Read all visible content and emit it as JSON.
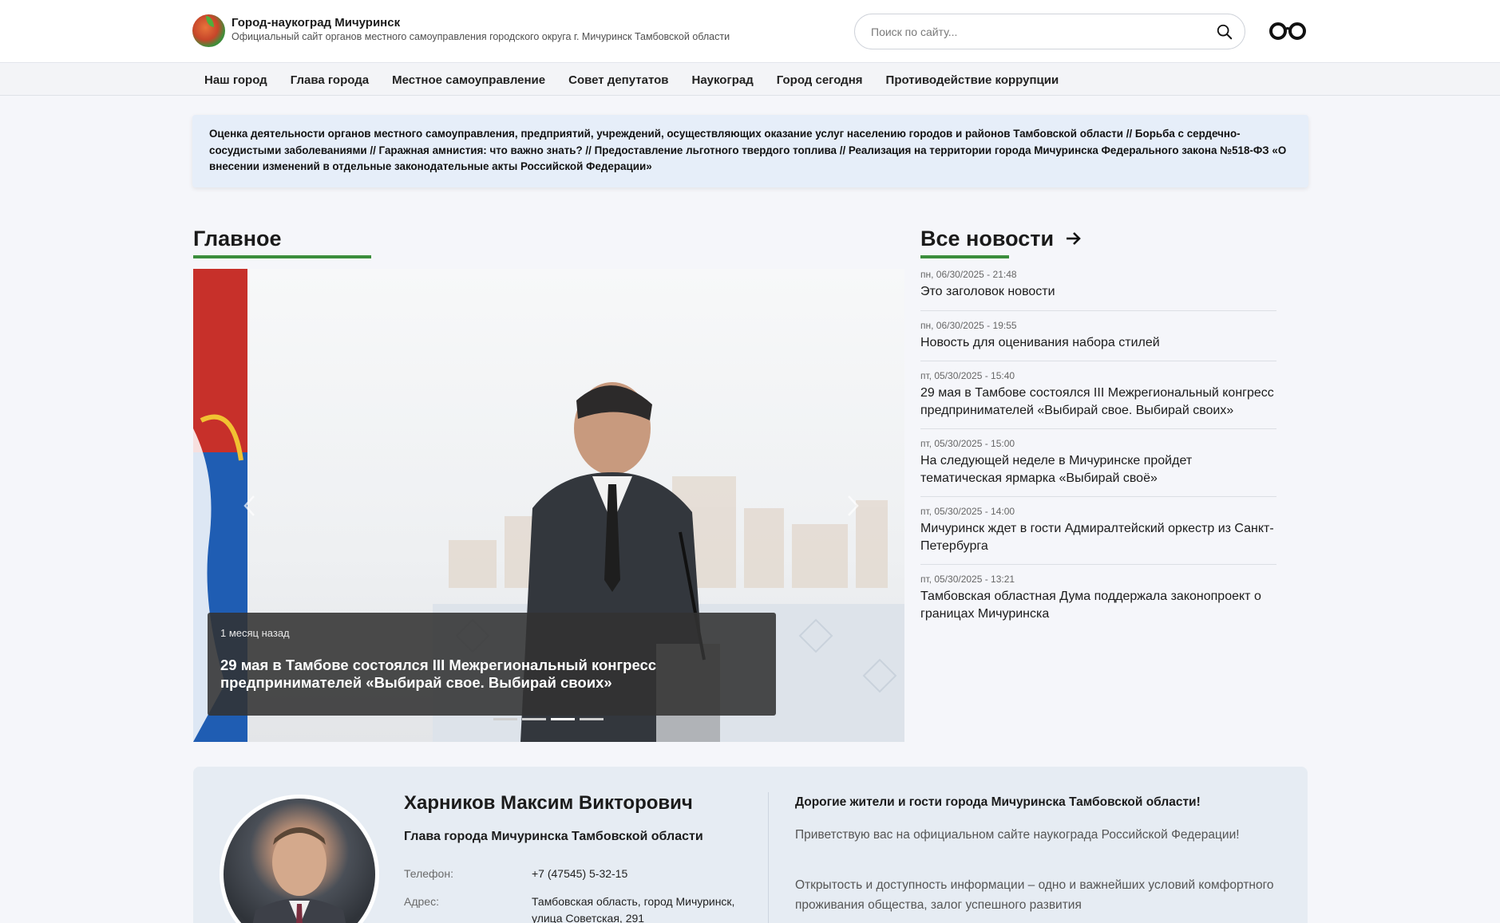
{
  "header": {
    "title": "Город-наукоград Мичуринск",
    "subtitle": "Официальный сайт органов местного самоуправления городского округа г. Мичуринск Тамбовской области",
    "search_placeholder": "Поиск по сайту..."
  },
  "nav": {
    "items": [
      "Наш город",
      "Глава города",
      "Местное самоуправление",
      "Совет депутатов",
      "Наукоград",
      "Город сегодня",
      "Противодействие коррупции"
    ]
  },
  "ticker": {
    "items": [
      "Оценка деятельности органов местного самоуправления, предприятий, учреждений, осуществляющих оказание услуг населению городов и районов Тамбовской области",
      "Борьба с сердечно-сосудистыми заболеваниями",
      "Гаражная амнистия: что важно знать?",
      "Предоставление льготного твердого топлива",
      "Реализация на территории города Мичуринска Федерального закона №518-ФЗ «О внесении изменений в отдельные законодательные акты Российской Федерации»"
    ],
    "separator": " // "
  },
  "main": {
    "section_title": "Главное",
    "slide": {
      "time": "1 месяц назад",
      "title": "29 мая в Тамбове состоялся III Межрегиональный конгресс предпринимателей «Выбирай свое. Выбирай своих»"
    },
    "slide_count": 4,
    "active_slide": 3
  },
  "news": {
    "section_title": "Все новости",
    "items": [
      {
        "date": "пн, 06/30/2025 - 21:48",
        "title": "Это заголовок новости"
      },
      {
        "date": "пн, 06/30/2025 - 19:55",
        "title": "Новость для оценивания набора стилей"
      },
      {
        "date": "пт, 05/30/2025 - 15:40",
        "title": "29 мая в Тамбове состоялся III Межрегиональный конгресс предпринимателей «Выбирай свое. Выбирай своих»"
      },
      {
        "date": "пт, 05/30/2025 - 15:00",
        "title": "На следующей неделе в Мичуринске пройдет тематическая ярмарка «Выбирай своё»"
      },
      {
        "date": "пт, 05/30/2025 - 14:00",
        "title": "Мичуринск ждет в гости Адмиралтейский оркестр из Санкт-Петербурга"
      },
      {
        "date": "пт, 05/30/2025 - 13:21",
        "title": "Тамбовская областная Дума поддержала законопроект о границах Мичуринска"
      }
    ]
  },
  "head": {
    "name": "Харников Максим Викторович",
    "role": "Глава города Мичуринска Тамбовской области",
    "phone_label": "Телефон:",
    "phone": "+7 (47545) 5-32-15",
    "address_label": "Адрес:",
    "address": "Тамбовская область, город Мичуринск, улица Советская, 291",
    "greeting_title": "Дорогие жители и гости города Мичуринска Тамбовской области!",
    "greeting_p1": "Приветствую вас на официальном сайте наукограда Российской Федерации!",
    "greeting_p2": "Открытость и доступность информации – одно и важнейших условий комфортного проживания общества, залог успешного развития"
  },
  "colors": {
    "accent_green": "#3b8e3c",
    "ticker_bg": "#e6eef9",
    "caption_bg": "#323232",
    "head_card_bg": "#e6ecf3"
  }
}
